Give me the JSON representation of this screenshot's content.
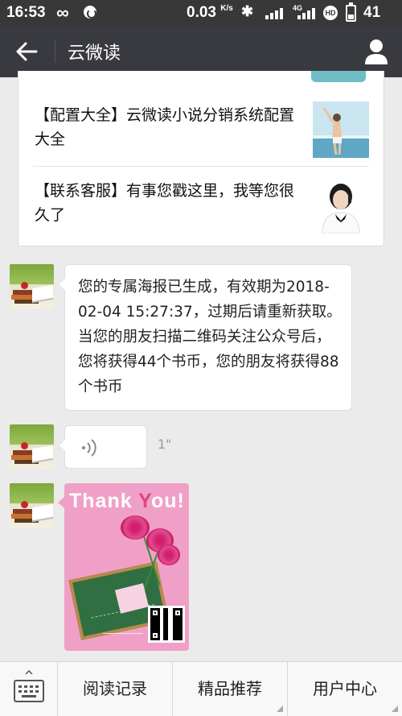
{
  "status_bar": {
    "time": "16:53",
    "infinity": "∞",
    "speed": "0.03",
    "speed_unit": "K/s",
    "network": "4G",
    "hd": "HD",
    "battery": "41"
  },
  "header": {
    "title": "云微读",
    "back_icon": "back-arrow-icon",
    "user_icon": "user-icon"
  },
  "article_card": {
    "items": [
      {
        "title": "【配置大全】云微读小说分销系统配置大全",
        "thumb": "beach-woman-image"
      },
      {
        "title": "【联系客服】有事您戳这里，我等您很久了",
        "thumb": "customer-service-woman-image"
      }
    ]
  },
  "messages": [
    {
      "type": "text",
      "text": "您的专属海报已生成，有效期为2018-02-04 15:27:37，过期后请重新获取。当您的朋友扫描二维码关注公众号后，您将获得44个书币，您的朋友将获得88个书币"
    },
    {
      "type": "voice",
      "duration": "1\""
    },
    {
      "type": "image",
      "poster_title_a": "Thank ",
      "poster_title_b": "Y",
      "poster_title_c": "ou!"
    }
  ],
  "bottom_menu": {
    "keyboard_icon": "keyboard-icon",
    "items": [
      "阅读记录",
      "精品推荐",
      "用户中心"
    ]
  }
}
